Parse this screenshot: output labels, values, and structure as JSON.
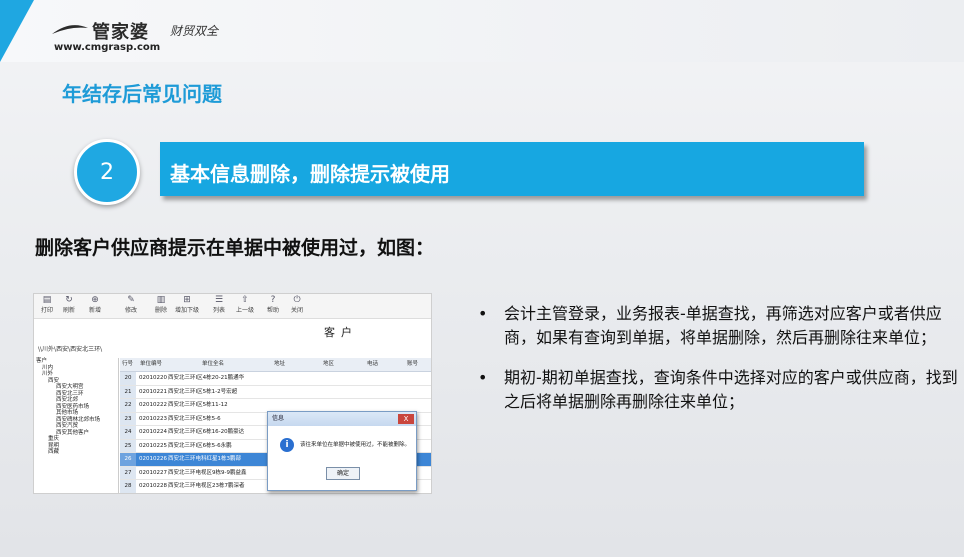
{
  "logo": {
    "brand": "管家婆",
    "product": "财贸双全",
    "url": "www.cmgrasp.com"
  },
  "page_title": "年结存后常见问题",
  "section": {
    "number": "2",
    "title": "基本信息删除，删除提示被使用"
  },
  "lead_text": "删除客户供应商提示在单据中被使用过，如图：",
  "screenshot": {
    "toolbar": [
      "打印",
      "刷新",
      "新增",
      "修改",
      "删除",
      "增加下级",
      "列表",
      "上一级",
      "帮助",
      "关闭"
    ],
    "window_title": "客户",
    "breadcrumb": "\\\\川外\\西安\\西安北三环\\",
    "tree": [
      "客户",
      "川内",
      "川外",
      "西安",
      "西安大明宫",
      "西安北三环",
      "西安北郊",
      "西安医药市场",
      "其他市场",
      "西安碑林北郊市场",
      "西安汽贸",
      "西安其他客户",
      "重庆",
      "昆明",
      "西藏"
    ],
    "columns": [
      "行号",
      "单位编号",
      "单位全名",
      "地址",
      "地区",
      "电话",
      "账号"
    ],
    "rows": [
      {
        "n": "20",
        "code": "02010220",
        "name": "西安北三环I区4栋20-21鹏通华"
      },
      {
        "n": "21",
        "code": "02010221",
        "name": "西安北三环I区5栋1-2号宏超"
      },
      {
        "n": "22",
        "code": "02010222",
        "name": "西安北三环I区5栋11-12"
      },
      {
        "n": "23",
        "code": "02010223",
        "name": "西安北三环I区5栋5-6"
      },
      {
        "n": "24",
        "code": "02010224",
        "name": "西安北三环I区6栋16-20鹏豪达"
      },
      {
        "n": "25",
        "code": "02010225",
        "name": "西安北三环I区6栋5-6永鹏"
      },
      {
        "n": "26",
        "code": "02010226",
        "name": "西安北三环电科红星1栋3鹏部",
        "selected": true
      },
      {
        "n": "27",
        "code": "02010227",
        "name": "西安北三环电视区9栋9-9鹏益鑫"
      },
      {
        "n": "28",
        "code": "02010228",
        "name": "西安北三环电视区23栋7鹏深者"
      }
    ],
    "dialog": {
      "title": "信息",
      "message": "该往来单位在单据中被使用过，不能被删除。",
      "ok_label": "确定",
      "close": "X"
    }
  },
  "bullets": [
    "会计主管登录，业务报表-单据查找，再筛选对应客户或者供应商，如果有查询到单据，将单据删除，然后再删除往来单位；",
    "期初-期初单据查找，查询条件中选择对应的客户或供应商，找到之后将单据删除再删除往来单位；"
  ],
  "colors": {
    "accent": "#1fa7e1",
    "title": "#1e9bd7"
  }
}
